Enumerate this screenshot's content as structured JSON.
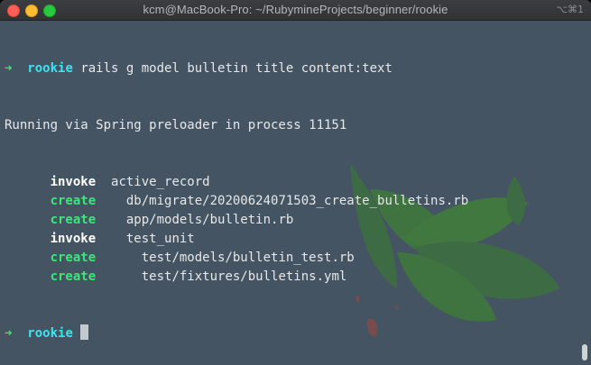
{
  "window": {
    "title": "kcm@MacBook-Pro: ~/RubymineProjects/beginner/rookie",
    "shortcut": "⌥⌘1"
  },
  "terminal": {
    "prompt_symbol": "➜",
    "prompt_dir": "rookie",
    "command": "rails g model bulletin title content:text",
    "output_header": "Running via Spring preloader in process 11151",
    "generator_lines": [
      {
        "action": "invoke",
        "indent": "      ",
        "gap": "  ",
        "path": "active_record"
      },
      {
        "action": "create",
        "indent": "      ",
        "gap": "    ",
        "path": "db/migrate/20200624071503_create_bulletins.rb"
      },
      {
        "action": "create",
        "indent": "      ",
        "gap": "    ",
        "path": "app/models/bulletin.rb"
      },
      {
        "action": "invoke",
        "indent": "      ",
        "gap": "    ",
        "path": "test_unit"
      },
      {
        "action": "create",
        "indent": "      ",
        "gap": "      ",
        "path": "test/models/bulletin_test.rb"
      },
      {
        "action": "create",
        "indent": "      ",
        "gap": "      ",
        "path": "test/fixtures/bulletins.yml"
      }
    ]
  },
  "colors": {
    "background": "#455463",
    "prompt_arrow": "#3ce67a",
    "prompt_dir": "#3ee2f0",
    "create": "#3ce67a",
    "invoke": "#ffffff",
    "text": "#e6e8ea"
  }
}
